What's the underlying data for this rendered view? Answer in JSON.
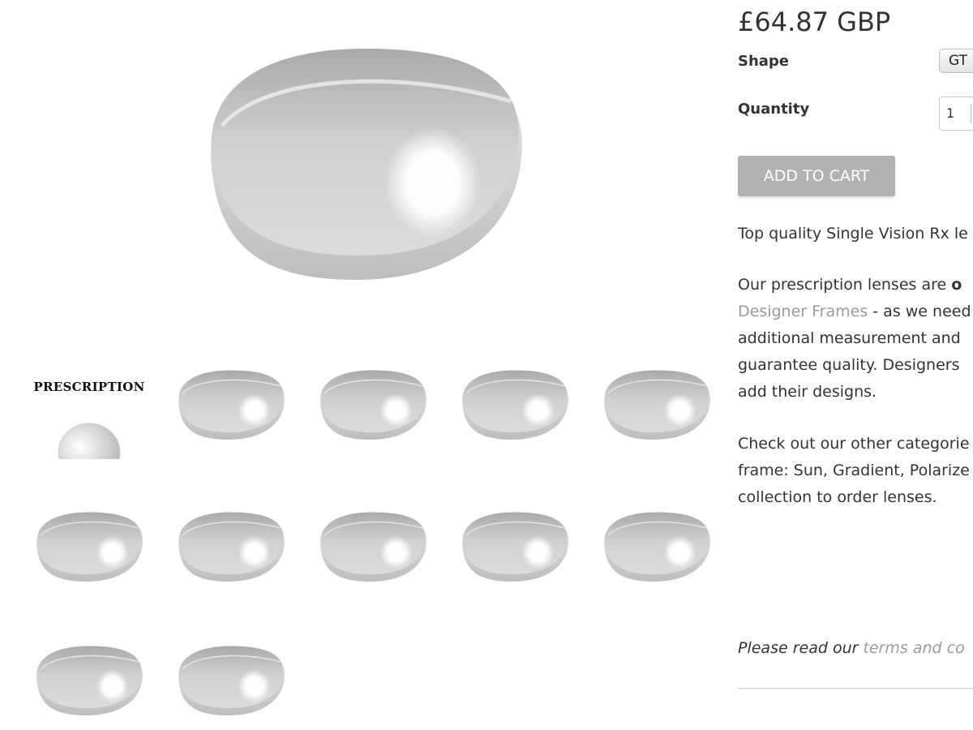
{
  "product": {
    "price": "£64.87 GBP",
    "shape_label": "Shape",
    "shape_value": "GT",
    "quantity_label": "Quantity",
    "quantity_value": "1",
    "add_to_cart": "ADD TO CART"
  },
  "description": {
    "p1": "Top quality Single Vision Rx le",
    "p2_line1_start": "Our prescription lenses are ",
    "p2_line1_bold": "o",
    "p2_line2_link": "Designer Frames",
    "p2_line2_rest": " - as we need",
    "p2_line3": "additional measurement and",
    "p2_line4": "guarantee quality. Designers",
    "p2_line5": "add their designs.",
    "p3_line1": "Check out our other categorie",
    "p3_line2": "frame: Sun, Gradient, Polarize",
    "p3_line3": "collection to order lenses."
  },
  "terms": {
    "prefix": "Please read our ",
    "link": "terms and co"
  },
  "thumbnails": {
    "first_label": "PRESCRIPTION"
  }
}
